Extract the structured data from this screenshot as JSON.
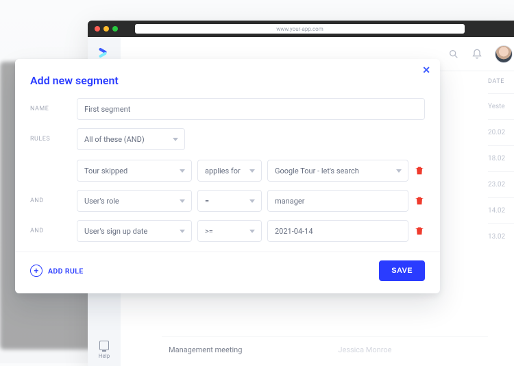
{
  "browser": {
    "url": "www.your-app.com"
  },
  "sidebar": {
    "help_label": "Help"
  },
  "header": {
    "date_label": "DATE"
  },
  "table": {
    "rows": [
      {
        "date": "Yeste"
      },
      {
        "date": "20.02"
      },
      {
        "date": "18.02"
      },
      {
        "date": "23.02"
      },
      {
        "date": "14.02"
      },
      {
        "date": "13.02"
      }
    ],
    "bottom": {
      "title": "Management meeting",
      "person": "Jessica Monroe"
    }
  },
  "modal": {
    "title": "Add new segment",
    "labels": {
      "name": "NAME",
      "rules": "RULES",
      "and": "AND",
      "add_rule": "ADD RULE",
      "save": "SAVE"
    },
    "name_value": "First segment",
    "combinator": "All of these (AND)",
    "rules": [
      {
        "field": "Tour skipped",
        "op": "applies for",
        "value": "Google Tour - let's search",
        "value_kind": "select"
      },
      {
        "field": "User's role",
        "op": "=",
        "value": "manager",
        "value_kind": "input"
      },
      {
        "field": "User's sign up date",
        "op": ">=",
        "value": "2021-04-14",
        "value_kind": "input"
      }
    ]
  }
}
